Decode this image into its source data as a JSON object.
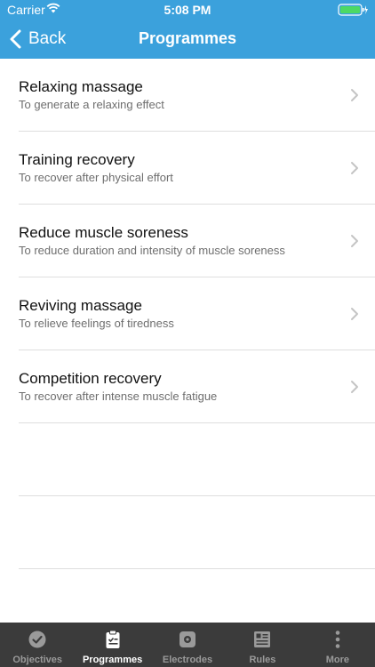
{
  "status_bar": {
    "carrier": "Carrier",
    "time": "5:08 PM"
  },
  "nav": {
    "back_label": "Back",
    "title": "Programmes"
  },
  "programmes": [
    {
      "title": "Relaxing massage",
      "subtitle": "To generate a relaxing effect"
    },
    {
      "title": "Training recovery",
      "subtitle": "To recover after physical effort"
    },
    {
      "title": "Reduce muscle soreness",
      "subtitle": "To reduce duration and intensity of muscle soreness"
    },
    {
      "title": "Reviving massage",
      "subtitle": "To relieve feelings of tiredness"
    },
    {
      "title": "Competition recovery",
      "subtitle": "To recover after intense muscle fatigue"
    }
  ],
  "tabs": [
    {
      "label": "Objectives",
      "icon": "check-circle-icon",
      "active": false
    },
    {
      "label": "Programmes",
      "icon": "clipboard-icon",
      "active": true
    },
    {
      "label": "Electrodes",
      "icon": "electrode-icon",
      "active": false
    },
    {
      "label": "Rules",
      "icon": "rules-icon",
      "active": false
    },
    {
      "label": "More",
      "icon": "more-dots-icon",
      "active": false
    }
  ],
  "colors": {
    "header_background": "#3ba1dc",
    "tabbar_background": "#3b3b3b",
    "battery": "#4cd964"
  }
}
